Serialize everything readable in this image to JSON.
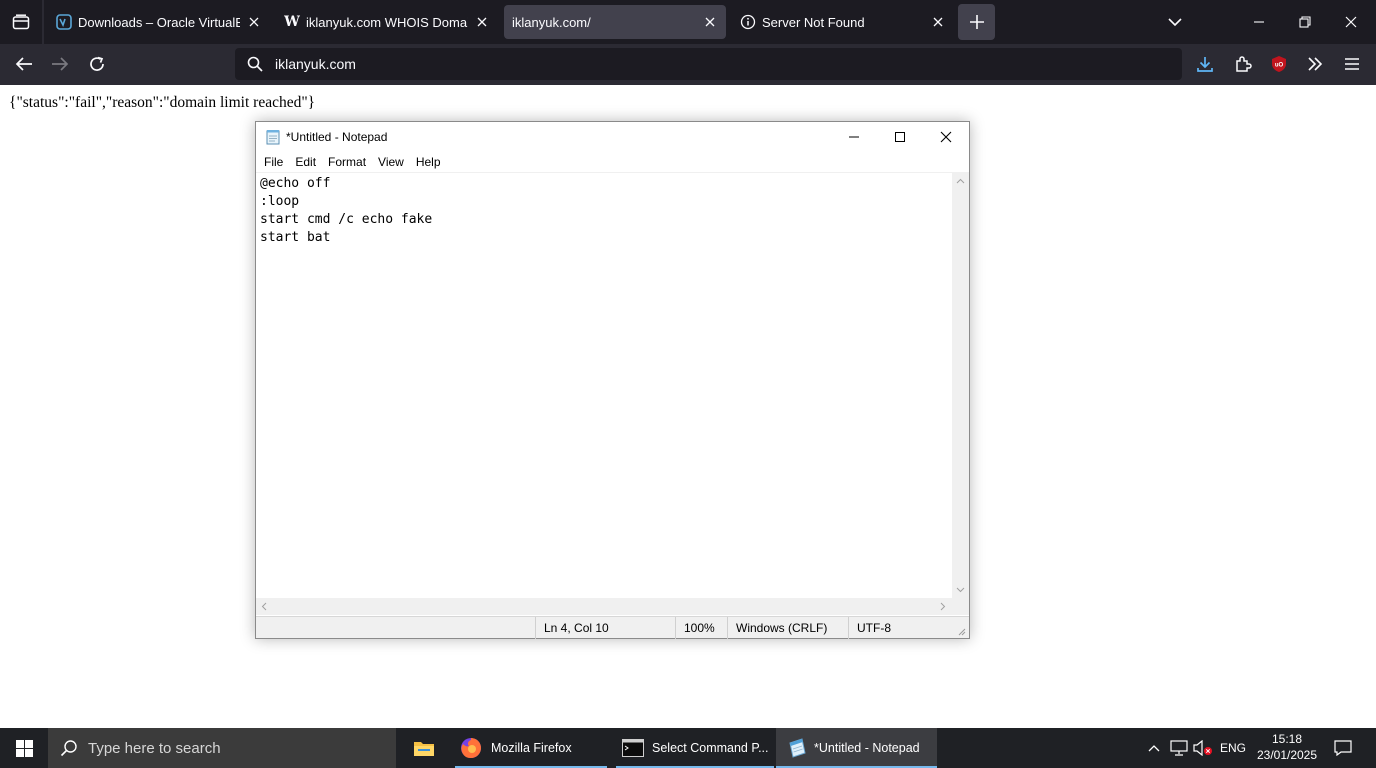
{
  "browser": {
    "tabs": [
      {
        "title": "Downloads – Oracle VirtualBox",
        "icon": "virtualbox-icon"
      },
      {
        "title": "iklanyuk.com WHOIS Domain N",
        "icon": "w-icon"
      },
      {
        "title": "iklanyuk.com/",
        "icon": "none",
        "active": true
      },
      {
        "title": "Server Not Found",
        "icon": "info-icon"
      }
    ],
    "url": "iklanyuk.com",
    "accent": "#42414d"
  },
  "page": {
    "body_text": "{\"status\":\"fail\",\"reason\":\"domain limit reached\"}"
  },
  "notepad": {
    "title": "*Untitled - Notepad",
    "menu": [
      "File",
      "Edit",
      "Format",
      "View",
      "Help"
    ],
    "content": "@echo off\n:loop\nstart cmd /c echo fake\nstart bat",
    "status": {
      "position": "Ln 4, Col 10",
      "zoom": "100%",
      "line_ending": "Windows (CRLF)",
      "encoding": "UTF-8"
    }
  },
  "taskbar": {
    "search_placeholder": "Type here to search",
    "apps": [
      {
        "label": "",
        "icon": "file-explorer-icon"
      },
      {
        "label": "Mozilla Firefox",
        "icon": "firefox-icon"
      },
      {
        "label": "Select Command P...",
        "icon": "cmd-icon"
      },
      {
        "label": "*Untitled - Notepad",
        "icon": "notepad-icon",
        "active": true
      }
    ],
    "language": "ENG",
    "time": "15:18",
    "date": "23/01/2025"
  }
}
